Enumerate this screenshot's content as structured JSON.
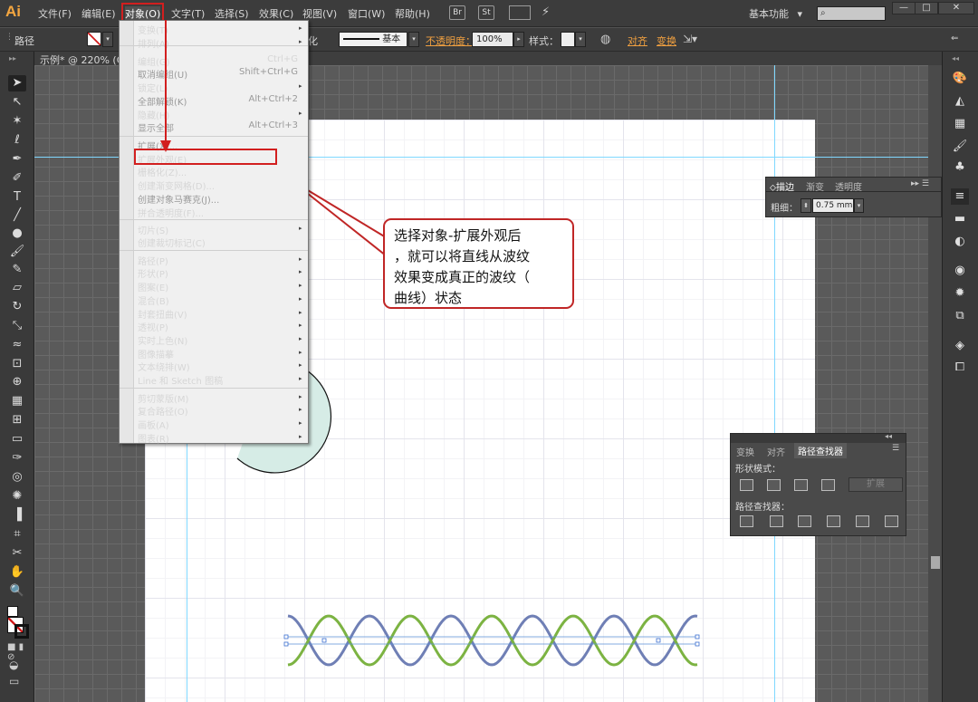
{
  "menubar": {
    "logo": "Ai",
    "items": [
      "文件(F)",
      "编辑(E)",
      "对象(O)",
      "文字(T)",
      "选择(S)",
      "效果(C)",
      "视图(V)",
      "窗口(W)",
      "帮助(H)"
    ],
    "icons": [
      "Br",
      "St"
    ],
    "workspace": "基本功能",
    "workspace_arrow": "▾",
    "search_placeholder": "",
    "window_buttons": [
      "—",
      "□",
      "✕"
    ]
  },
  "control_bar": {
    "selection_label": "路径",
    "stroke_style_suffix": "化",
    "brush": "基本",
    "opacity_label": "不透明度：",
    "opacity_value": "100%",
    "style_label": "样式：",
    "align_label": "对齐",
    "transform_label": "变换"
  },
  "document": {
    "tab_title": "示例* @ 220% (C"
  },
  "object_menu": {
    "items": [
      {
        "label": "变换(T)",
        "shortcut": "",
        "submenu": true,
        "disabled": false
      },
      {
        "label": "排列(A)",
        "shortcut": "",
        "submenu": true,
        "disabled": false
      },
      {
        "label": "编组(G)",
        "shortcut": "Ctrl+G",
        "submenu": false,
        "disabled": false
      },
      {
        "label": "取消编组(U)",
        "shortcut": "Shift+Ctrl+G",
        "submenu": false,
        "disabled": true
      },
      {
        "label": "锁定(L)",
        "shortcut": "",
        "submenu": true,
        "disabled": false
      },
      {
        "label": "全部解锁(K)",
        "shortcut": "Alt+Ctrl+2",
        "submenu": false,
        "disabled": true
      },
      {
        "label": "隐藏(H)",
        "shortcut": "",
        "submenu": true,
        "disabled": false
      },
      {
        "label": "显示全部",
        "shortcut": "Alt+Ctrl+3",
        "submenu": false,
        "disabled": true
      },
      {
        "label": "扩展(X)...",
        "shortcut": "",
        "submenu": false,
        "disabled": true
      },
      {
        "label": "扩展外观(E)",
        "shortcut": "",
        "submenu": false,
        "disabled": false
      },
      {
        "label": "栅格化(Z)...",
        "shortcut": "",
        "submenu": false,
        "disabled": false
      },
      {
        "label": "创建渐变网格(D)...",
        "shortcut": "",
        "submenu": false,
        "disabled": false
      },
      {
        "label": "创建对象马赛克(J)...",
        "shortcut": "",
        "submenu": false,
        "disabled": true
      },
      {
        "label": "拼合透明度(F)...",
        "shortcut": "",
        "submenu": false,
        "disabled": false
      },
      {
        "label": "切片(S)",
        "shortcut": "",
        "submenu": true,
        "disabled": false
      },
      {
        "label": "创建裁切标记(C)",
        "shortcut": "",
        "submenu": false,
        "disabled": false
      },
      {
        "label": "路径(P)",
        "shortcut": "",
        "submenu": true,
        "disabled": false
      },
      {
        "label": "形状(P)",
        "shortcut": "",
        "submenu": true,
        "disabled": false
      },
      {
        "label": "图案(E)",
        "shortcut": "",
        "submenu": true,
        "disabled": false
      },
      {
        "label": "混合(B)",
        "shortcut": "",
        "submenu": true,
        "disabled": false
      },
      {
        "label": "封套扭曲(V)",
        "shortcut": "",
        "submenu": true,
        "disabled": false
      },
      {
        "label": "透视(P)",
        "shortcut": "",
        "submenu": true,
        "disabled": false
      },
      {
        "label": "实时上色(N)",
        "shortcut": "",
        "submenu": true,
        "disabled": false
      },
      {
        "label": "图像描摹",
        "shortcut": "",
        "submenu": true,
        "disabled": false
      },
      {
        "label": "文本绕排(W)",
        "shortcut": "",
        "submenu": true,
        "disabled": false
      },
      {
        "label": "Line 和 Sketch 图稿",
        "shortcut": "",
        "submenu": true,
        "disabled": false
      },
      {
        "label": "剪切蒙版(M)",
        "shortcut": "",
        "submenu": true,
        "disabled": false
      },
      {
        "label": "复合路径(O)",
        "shortcut": "",
        "submenu": true,
        "disabled": false
      },
      {
        "label": "画板(A)",
        "shortcut": "",
        "submenu": true,
        "disabled": false
      },
      {
        "label": "图表(R)",
        "shortcut": "",
        "submenu": true,
        "disabled": false
      }
    ]
  },
  "callout": {
    "lines": [
      "选择对象-扩展外观后",
      "，就可以将直线从波纹",
      "效果变成真正的波纹（",
      "曲线）状态"
    ]
  },
  "stroke_panel": {
    "tabs": [
      "描边",
      "渐变",
      "透明度"
    ],
    "weight_label": "粗细：",
    "weight_value": "0.75 mm"
  },
  "pathfinder_panel": {
    "tabs": [
      "变换",
      "对齐",
      "路径查找器"
    ],
    "shape_modes_label": "形状模式：",
    "expand_button": "扩展",
    "pathfinders_label": "路径查找器："
  },
  "colors": {
    "wave_green": "#7cb342",
    "wave_blue": "#6f7fb5",
    "circle_fill": "#d6ece6",
    "highlight_red": "#d21f1f"
  }
}
